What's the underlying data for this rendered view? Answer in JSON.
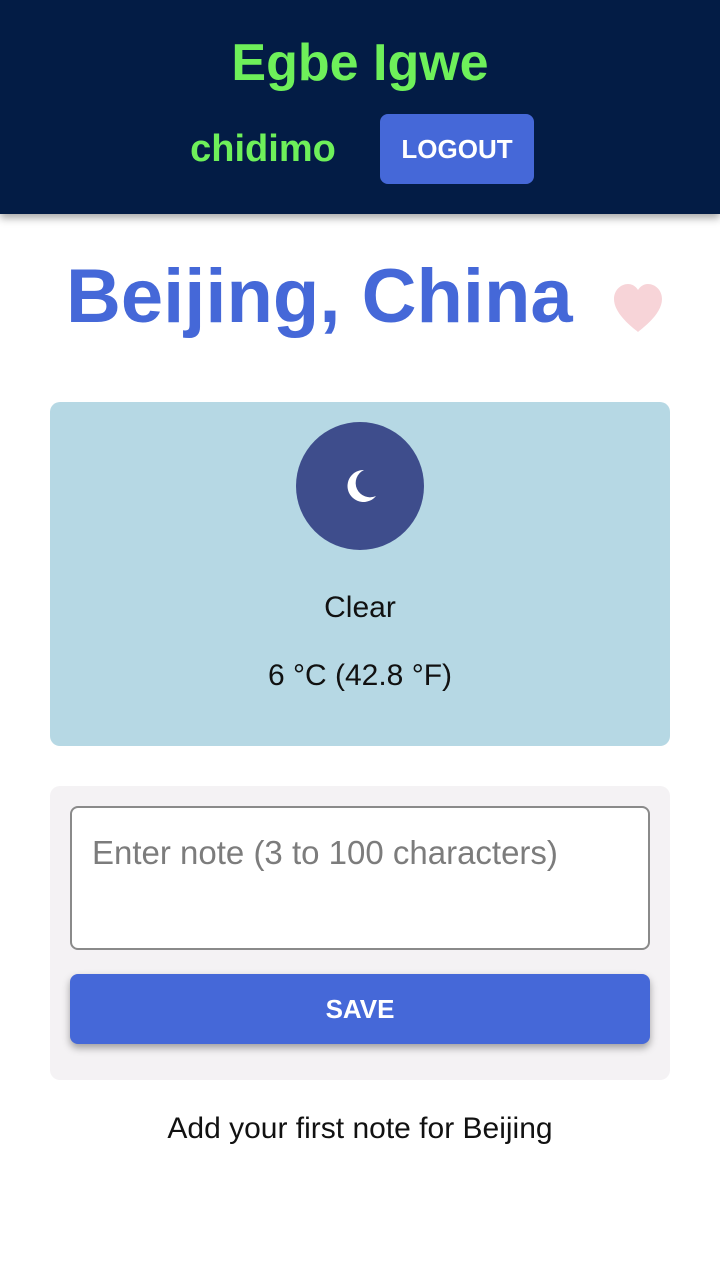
{
  "header": {
    "brand": "Egbe Igwe",
    "username": "chidimo",
    "logout_label": "LOGOUT",
    "background_color": "#031c45",
    "brand_color": "#6ef05a"
  },
  "location": {
    "title": "Beijing, China",
    "favorite_icon": "heart-icon",
    "favorite_color": "#f7d4d8"
  },
  "weather": {
    "icon": "moon-icon",
    "description": "Clear",
    "temperature": "6 °C (42.8 °F)",
    "card_color": "#b6d8e4"
  },
  "note_form": {
    "placeholder": "Enter note (3 to 100 characters)",
    "value": "",
    "save_label": "SAVE"
  },
  "notes": {
    "empty_message": "Add your first note for Beijing"
  },
  "theme": {
    "accent": "#4568d8"
  }
}
